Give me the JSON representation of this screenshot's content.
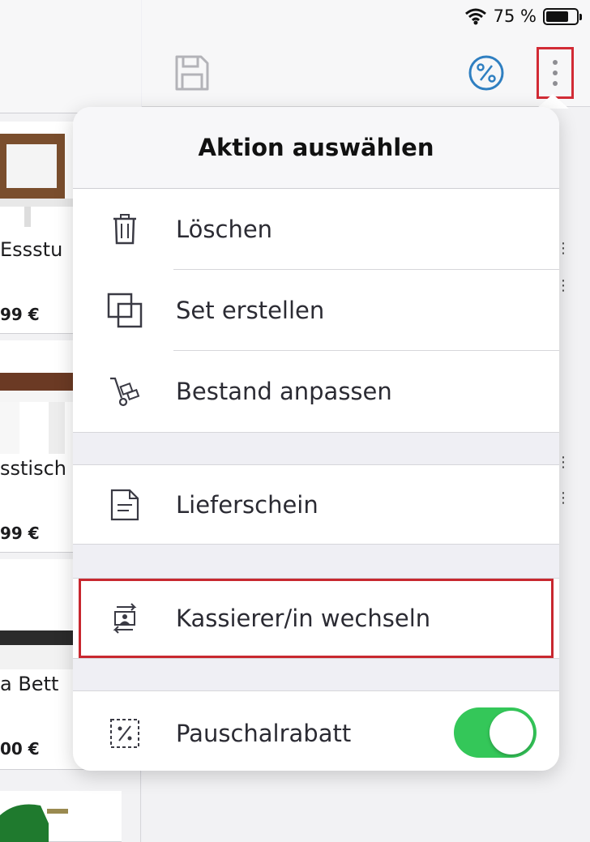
{
  "status_bar": {
    "battery_percent": "75 %",
    "battery_level": 0.75
  },
  "toolbar": {
    "save_icon": "save-disk-icon",
    "discount_icon": "percent-circle-icon",
    "more_icon": "vertical-ellipsis-icon"
  },
  "products": [
    {
      "name": "Essstu",
      "price": "99 €"
    },
    {
      "name": "sstisch",
      "price": "99 €"
    },
    {
      "name": "a Bett",
      "price": "00 €"
    }
  ],
  "popover": {
    "title": "Aktion auswählen",
    "items": [
      {
        "label": "Löschen",
        "icon": "trash-icon"
      },
      {
        "label": "Set erstellen",
        "icon": "overlapping-squares-icon"
      },
      {
        "label": "Bestand anpassen",
        "icon": "hand-truck-icon"
      },
      {
        "label": "Lieferschein",
        "icon": "document-icon"
      },
      {
        "label": "Kassierer/in wechseln",
        "icon": "switch-cashier-icon"
      },
      {
        "label": "Pauschalrabatt",
        "icon": "dashed-percent-icon",
        "toggle_on": true
      }
    ]
  },
  "colors": {
    "accent_blue": "#2f7fc1",
    "toggle_green": "#34c759",
    "highlight_red": "#d22b35"
  }
}
